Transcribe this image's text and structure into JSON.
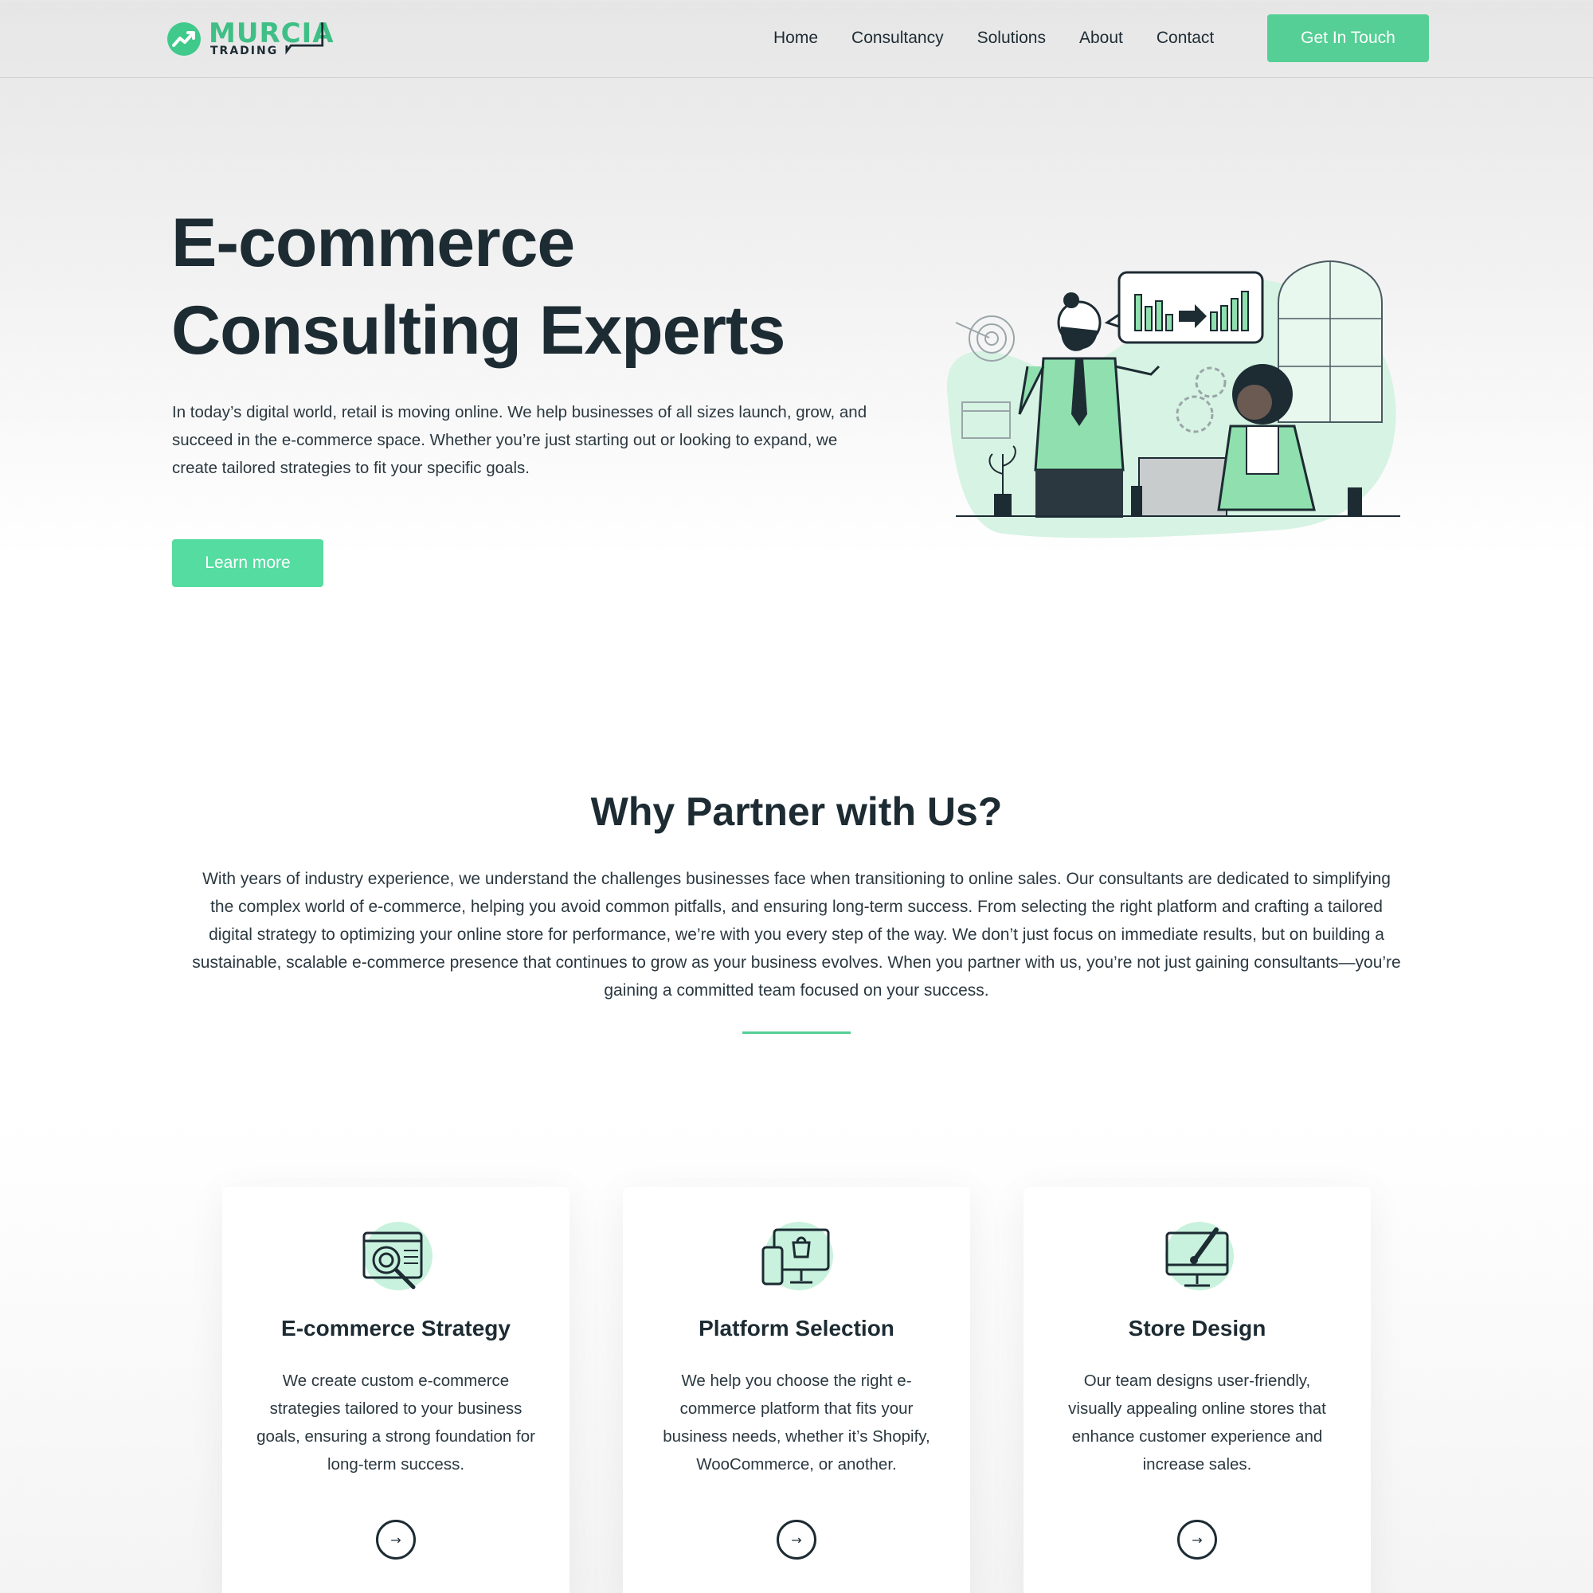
{
  "brand": {
    "name": "MURCIA",
    "sub": "TRADING",
    "accent_color": "#55cf95"
  },
  "nav": {
    "items": [
      "Home",
      "Consultancy",
      "Solutions",
      "About",
      "Contact"
    ],
    "cta_label": "Get In Touch"
  },
  "hero": {
    "title_line1": "E-commerce",
    "title_line2": "Consulting Experts",
    "text": "In today’s digital world, retail is moving online. We help businesses of all sizes launch, grow, and succeed in the e-commerce space. Whether you’re just starting out or looking to expand, we create tailored strategies to fit your specific goals.",
    "button_label": "Learn more"
  },
  "why": {
    "title": "Why Partner with Us?",
    "text": "With years of industry experience, we understand the challenges businesses face when transitioning to online sales. Our consultants are dedicated to simplifying the complex world of e-commerce, helping you avoid common pitfalls, and ensuring long-term success. From selecting the right platform and crafting a tailored digital strategy to optimizing your online store for performance, we’re with you every step of the way. We don’t just focus on immediate results, but on building a sustainable, scalable e-commerce presence that continues to grow as your business evolves. When you partner with us, you’re not just gaining consultants—you’re gaining a committed team focused on your success."
  },
  "cards": [
    {
      "icon": "strategy-target-icon",
      "title": "E-commerce Strategy",
      "text": "We create custom e-commerce strategies tailored to your business goals, ensuring a strong foundation for long-term success.",
      "arrow": "→"
    },
    {
      "icon": "devices-shopping-icon",
      "title": "Platform Selection",
      "text": "We help you choose the right e-commerce platform that fits your business needs, whether it’s Shopify, WooCommerce, or another.",
      "arrow": "→"
    },
    {
      "icon": "monitor-brush-icon",
      "title": "Store Design",
      "text": "Our team designs user-friendly, visually appealing online stores that enhance customer experience and increase sales.",
      "arrow": "→"
    }
  ]
}
